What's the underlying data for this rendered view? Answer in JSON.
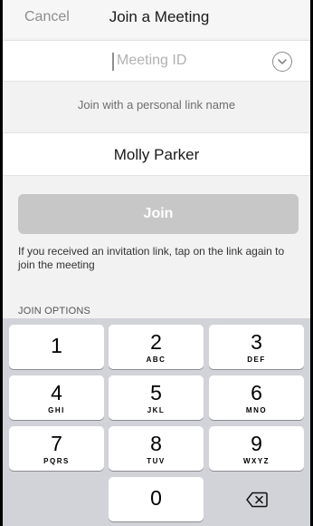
{
  "header": {
    "cancel_label": "Cancel",
    "title": "Join a Meeting"
  },
  "meeting_id": {
    "placeholder": "Meeting ID",
    "value": "",
    "dropdown_icon": "chevron-down-circle-icon"
  },
  "personal_link": {
    "label": "Join with a personal link name"
  },
  "name_field": {
    "value": "Molly Parker"
  },
  "join_button": {
    "label": "Join",
    "enabled": false,
    "color": "#c7c7c7"
  },
  "info_text": "If you received an invitation link, tap on the link again to join the meeting",
  "options_label": "JOIN OPTIONS",
  "keypad": {
    "keys": [
      {
        "num": "1",
        "letters": ""
      },
      {
        "num": "2",
        "letters": "ABC"
      },
      {
        "num": "3",
        "letters": "DEF"
      },
      {
        "num": "4",
        "letters": "GHI"
      },
      {
        "num": "5",
        "letters": "JKL"
      },
      {
        "num": "6",
        "letters": "MNO"
      },
      {
        "num": "7",
        "letters": "PQRS"
      },
      {
        "num": "8",
        "letters": "TUV"
      },
      {
        "num": "9",
        "letters": "WXYZ"
      },
      {
        "num": "0",
        "letters": ""
      }
    ],
    "delete_icon": "backspace-icon"
  }
}
